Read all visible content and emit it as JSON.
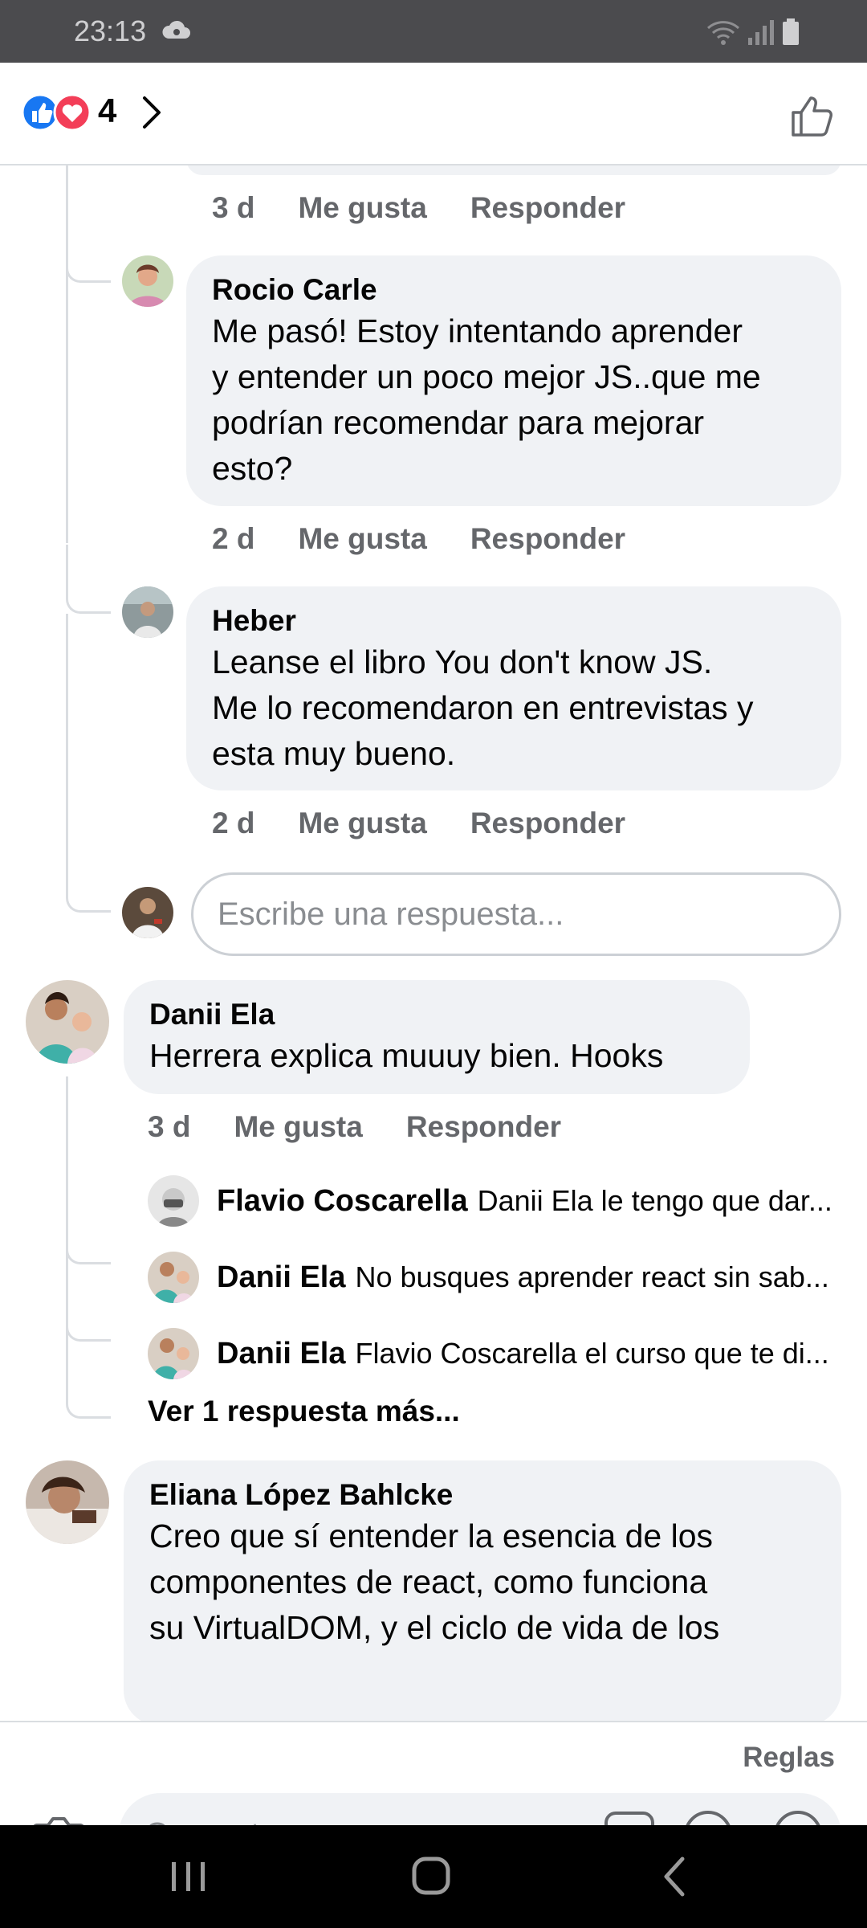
{
  "status_bar": {
    "time": "23:13"
  },
  "header": {
    "reaction_count": "4"
  },
  "comments": [
    {
      "meta_time": "3 d",
      "like_label": "Me gusta",
      "reply_label": "Responder"
    },
    {
      "author": "Rocio Carle",
      "lines": [
        "Me pasó! Estoy intentando aprender",
        "y entender un poco mejor JS..que me",
        "podrían recomendar para mejorar",
        "esto?"
      ],
      "meta_time": "2 d",
      "like_label": "Me gusta",
      "reply_label": "Responder"
    },
    {
      "author": "Heber",
      "lines": [
        "Leanse el libro You don't know JS.",
        "Me lo recomendaron en entrevistas y",
        "esta muy bueno."
      ],
      "meta_time": "2 d",
      "like_label": "Me gusta",
      "reply_label": "Responder"
    },
    {
      "author": "Danii Ela",
      "lines": [
        "Herrera explica muuuy bien. Hooks"
      ],
      "meta_time": "3 d",
      "like_label": "Me gusta",
      "reply_label": "Responder"
    },
    {
      "author": "Eliana López Bahlcke",
      "lines": [
        "Creo que sí entender la esencia de los",
        "componentes de react, como funciona",
        "su VirtualDOM, y el ciclo de vida de los"
      ]
    }
  ],
  "reply_input": {
    "placeholder": "Escribe una respuesta..."
  },
  "reply_previews": [
    {
      "author": "Flavio Coscarella",
      "text": "Danii Ela le tengo que dar..."
    },
    {
      "author": "Danii Ela",
      "text": "No busques aprender react sin sab..."
    },
    {
      "author": "Danii Ela",
      "text": "Flavio Coscarella el curso que te di..."
    }
  ],
  "more_replies": "Ver 1 respuesta más...",
  "footer": {
    "rules": "Reglas",
    "comment_placeholder": "Comentar..."
  },
  "icons": [
    "like-reaction-icon",
    "love-reaction-icon",
    "chevron-right-icon",
    "like-outline-icon",
    "camera-icon",
    "gif-icon",
    "sticker-icon",
    "emoji-icon",
    "recent-apps-icon",
    "home-icon",
    "back-icon"
  ],
  "colors": {
    "like_blue": "#1877f2",
    "love_red": "#f33e58",
    "bubble_bg": "#f0f2f5",
    "meta_grey": "#65676b"
  }
}
